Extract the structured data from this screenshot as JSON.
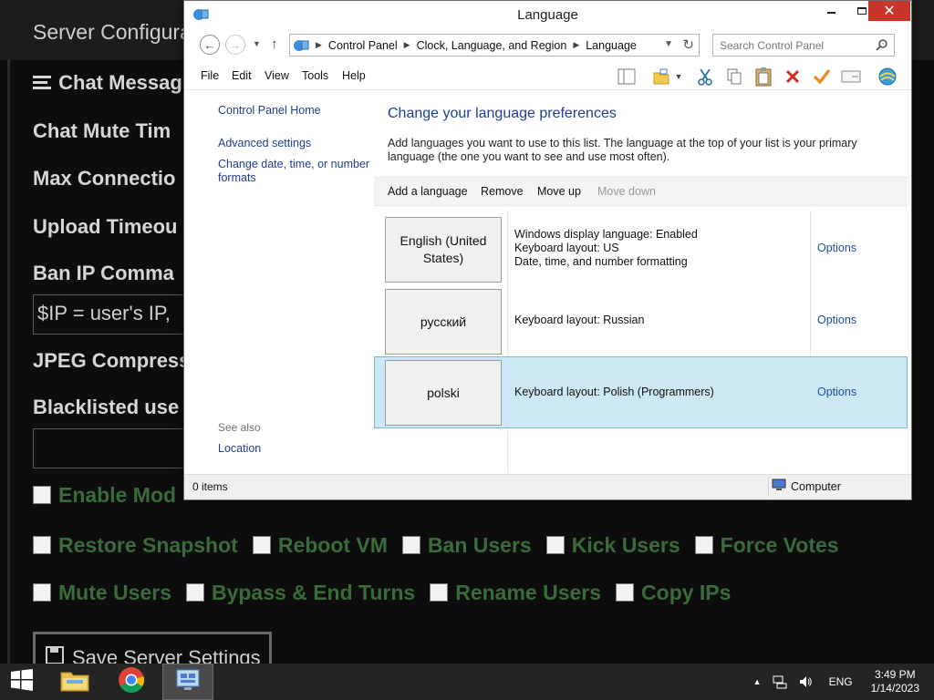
{
  "background_app": {
    "title": "Server Configura",
    "fields": [
      {
        "label": "Chat Messag",
        "has_icon": true
      },
      {
        "label": "Chat Mute Tim"
      },
      {
        "label": "Max Connectio"
      },
      {
        "label": "Upload Timeou"
      },
      {
        "label": "Ban IP Comma"
      }
    ],
    "ban_ip_input_value": "$IP = user's IP,",
    "jpeg_label": "JPEG Compress",
    "blacklist_label": "Blacklisted use",
    "blacklist_input_value": "",
    "checkbox_rows": [
      [
        {
          "label": "Enable Mod"
        }
      ],
      [
        {
          "label": "Restore Snapshot"
        },
        {
          "label": "Reboot VM"
        },
        {
          "label": "Ban Users"
        },
        {
          "label": "Kick Users"
        },
        {
          "label": "Force Votes"
        }
      ],
      [
        {
          "label": "Mute Users"
        },
        {
          "label": "Bypass & End Turns"
        },
        {
          "label": "Rename Users"
        },
        {
          "label": "Copy IPs"
        }
      ]
    ],
    "save_button_label": "Save Server Settings"
  },
  "window": {
    "title": "Language",
    "close_glyph": "✕",
    "breadcrumbs": [
      "Control Panel",
      "Clock, Language, and Region",
      "Language"
    ],
    "search_placeholder": "Search Control Panel",
    "menu": [
      "File",
      "Edit",
      "View",
      "Tools",
      "Help"
    ],
    "left_nav": {
      "home": "Control Panel Home",
      "advanced": "Advanced settings",
      "change_date": "Change date, time, or number formats",
      "see_also": "See also",
      "location": "Location"
    },
    "heading": "Change your language preferences",
    "description": "Add languages you want to use to this list. The language at the top of your list is your primary language (the one you want to see and use most often).",
    "commands": {
      "add": "Add a language",
      "remove": "Remove",
      "move_up": "Move up",
      "move_down": "Move down"
    },
    "languages": [
      {
        "name": "English (United States)",
        "info": [
          "Windows display language: Enabled",
          "Keyboard layout: US",
          "Date, time, and number formatting"
        ],
        "options": "Options",
        "selected": false
      },
      {
        "name": "русский",
        "info": [
          "Keyboard layout: Russian"
        ],
        "options": "Options",
        "selected": false
      },
      {
        "name": "polski",
        "info": [
          "Keyboard layout: Polish (Programmers)"
        ],
        "options": "Options",
        "selected": true
      }
    ],
    "status_items": "0 items",
    "status_computer": "Computer"
  },
  "taskbar": {
    "language": "ENG",
    "time": "3:49 PM",
    "date": "1/14/2023"
  },
  "colors": {
    "selection": "#cce8f4",
    "link": "#1e3f8f",
    "close_button": "#c7352b",
    "checkbox_text": "#3a6b3a"
  }
}
